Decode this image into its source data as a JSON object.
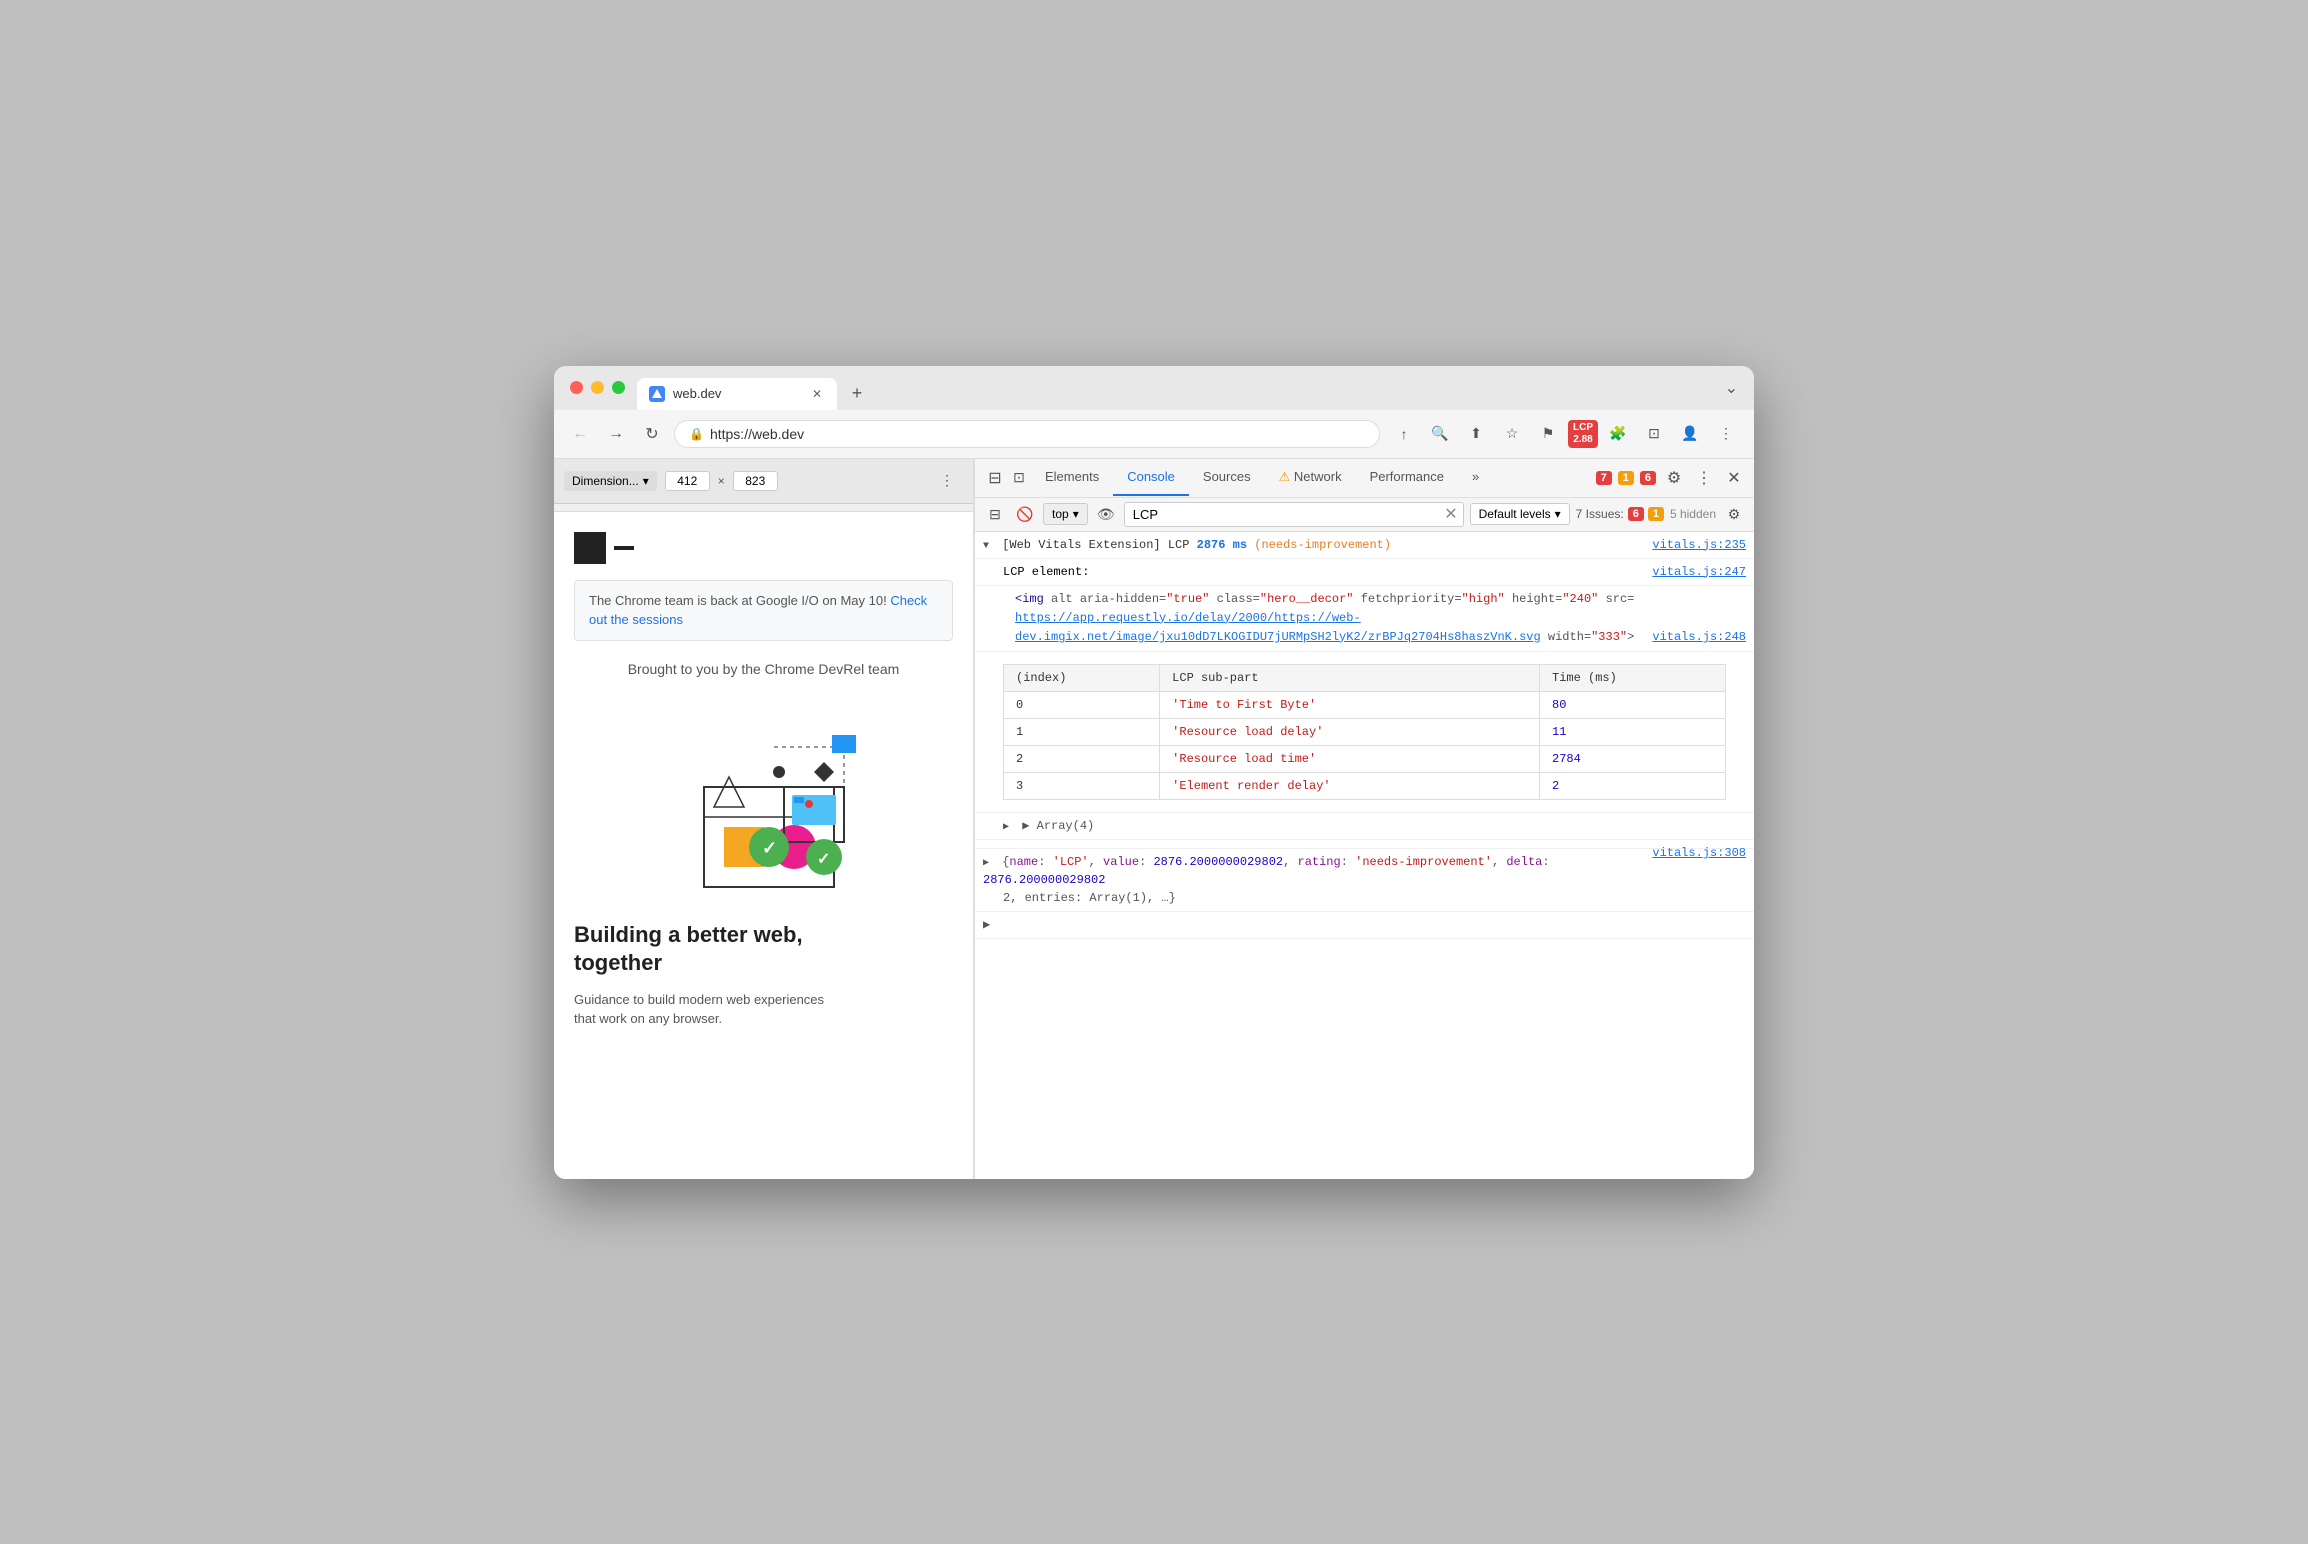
{
  "browser": {
    "title": "web.dev",
    "url": "https://web.dev",
    "tab_label": "web.dev",
    "new_tab_label": "+",
    "overflow_label": "⌄"
  },
  "toolbar": {
    "back_label": "←",
    "forward_label": "→",
    "reload_label": "↻",
    "save_label": "↑",
    "search_label": "🔍",
    "share_label": "⬆",
    "bookmark_label": "☆",
    "flag_label": "⚑",
    "lcp_label": "LCP",
    "lcp_value": "2.88",
    "extension_label": "🧩",
    "split_label": "⊡",
    "avatar_label": "👤",
    "more_label": "⋮"
  },
  "device_bar": {
    "dimension_label": "Dimension...",
    "width": "412",
    "height": "823",
    "more_label": "⋮"
  },
  "webpage": {
    "notification_text": "The Chrome team is back at Google I/O on May 10!",
    "notification_link": "Check out the sessions",
    "brought_by": "Brought to you by the Chrome DevRel team",
    "hero_title_line1": "Building a better web,",
    "hero_title_line2": "together",
    "hero_subtitle_line1": "Guidance to build modern web experiences",
    "hero_subtitle_line2": "that work on any browser."
  },
  "devtools": {
    "tabs": [
      {
        "label": "Elements",
        "active": false
      },
      {
        "label": "Console",
        "active": true
      },
      {
        "label": "Sources",
        "active": false
      },
      {
        "label": "Network",
        "active": false,
        "warning": true
      },
      {
        "label": "Performance",
        "active": false
      }
    ],
    "tab_more": "»",
    "error_count": "7",
    "warn_count": "1",
    "error_badge2": "6",
    "settings_label": "⚙",
    "more_label": "⋮",
    "close_label": "✕"
  },
  "console_toolbar": {
    "clear_label": "🚫",
    "filter_placeholder": "LCP",
    "filter_value": "LCP",
    "context_label": "top",
    "eye_label": "👁",
    "levels_label": "Default levels",
    "issues_label": "7 Issues:",
    "issues_errors": "6",
    "issues_messages": "1",
    "hidden_label": "5 hidden",
    "settings_label": "⚙"
  },
  "console_entries": {
    "lcp_entry": {
      "prefix": "[Web Vitals Extension] LCP",
      "value": "2876 ms",
      "rating": "(needs-improvement)",
      "file_ref": "vitals.js:235"
    },
    "lcp_element": {
      "label": "LCP element:",
      "file_ref": "vitals.js:247"
    },
    "img_tag": {
      "open": "<img",
      "attrs": "alt aria-hidden=\"true\" class=\"hero__decor\" fetchpriority=\"high\" height=\"240\"",
      "src_label": "src=\"",
      "src_link": "https://app.requestly.io/delay/2000/https://web-dev.imgix.net/image/jxu10dD7LKOGIDU7jURMpSH2lyK2/zrBPJq2704Hs8haszVnK.svg",
      "src_end": "\"",
      "width_attr": "width=\"333\"",
      "close": ">",
      "file_ref": "vitals.js:248"
    },
    "table": {
      "headers": [
        "(index)",
        "LCP sub-part",
        "Time (ms)"
      ],
      "rows": [
        {
          "index": "0",
          "subpart": "'Time to First Byte'",
          "time": "80"
        },
        {
          "index": "1",
          "subpart": "'Resource load delay'",
          "time": "11"
        },
        {
          "index": "2",
          "subpart": "'Resource load time'",
          "time": "2784"
        },
        {
          "index": "3",
          "subpart": "'Element render delay'",
          "time": "2"
        }
      ]
    },
    "array_entry": "▶ Array(4)",
    "object_entry": {
      "file_ref": "vitals.js:308",
      "arrow": "▶",
      "content": "{name: 'LCP', value: 2876.2000000029802, rating: 'needs-improvement', delta: 2876.200000029802, entries: Array(1), …}"
    },
    "final_arrow": "▶"
  }
}
